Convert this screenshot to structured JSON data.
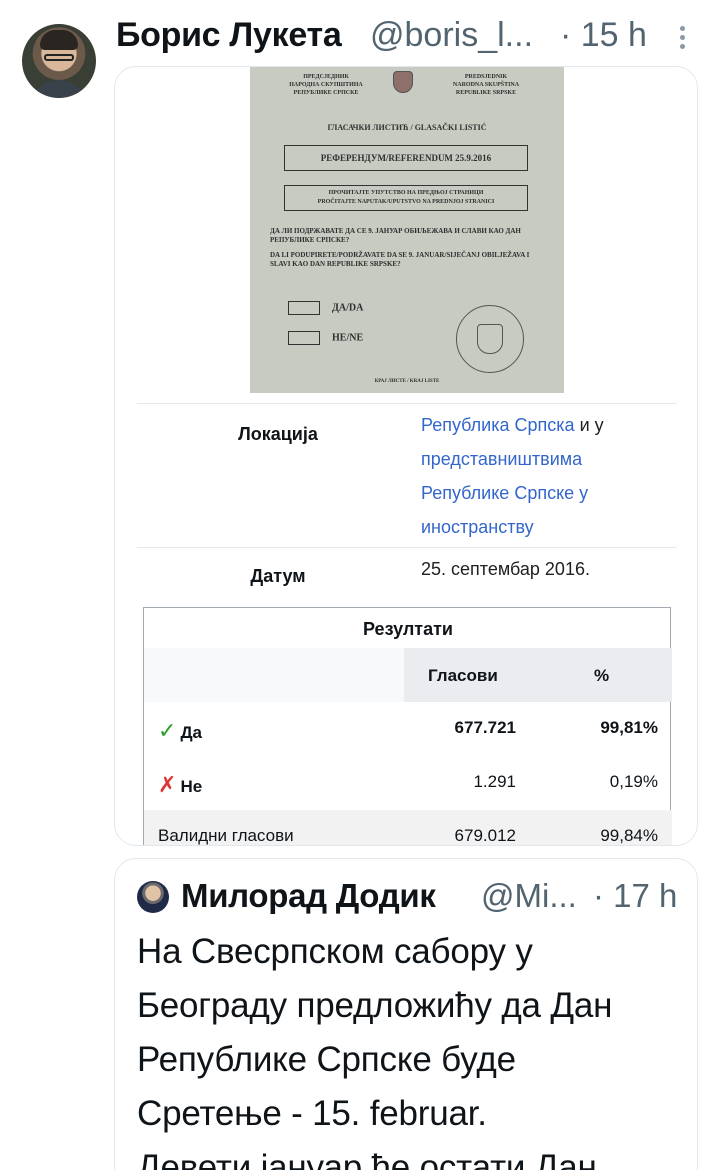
{
  "tweet": {
    "author_name": "Борис Лукета",
    "author_handle": "@boris_l...",
    "time": "· 15 h",
    "avatar_icon": "user-avatar"
  },
  "ballot": {
    "header_left": "ПРЕДСЈЕДНИК\nНАРОДНА СКУПШТИНА\nРЕПУБЛИКЕ СРПСКЕ",
    "header_right": "PREDSJEDNIK\nNARODNA SKUPŠTINA\nREPUBLIKE SRPSKE",
    "title": "ГЛАСАЧКИ ЛИСТИЋ / GLASAČKI LISTIĆ",
    "referendum": "РЕФЕРЕНДУМ/REFERENDUM 25.9.2016",
    "instructions": "ПРОЧИТАЈТЕ УПУТСТВО НА ПРЕДЊОЈ СТРАНИЦИ\nPROČITAJTE NAPUTAK/UPUTSTVO NA PREDNJOJ STRANICI",
    "question_cyr": "ДА ЛИ ПОДРЖАВАТЕ ДА СЕ 9. ЈАНУАР ОБИЉЕЖАВА И СЛАВИ КАО ДАН РЕПУБЛИКЕ СРПСКЕ?",
    "question_lat": "DA LI PODUPIRETE/PODRŽAVATE DA SE 9. JANUAR/SIJEČANJ OBILJEŽAVA I SLAVI KAO DAN REPUBLIKE SRPSKE?",
    "option_yes": "ДА/DA",
    "option_no": "НЕ/NE",
    "footer": "КРАЈ ЛИСТЕ / KRAJ LISTE"
  },
  "infobox": {
    "location_label": "Локација",
    "location_link1": "Република Српска",
    "location_conj": " и у",
    "location_link2": "представништвима",
    "location_link3": "Републике Српске у",
    "location_link4": "иностранству",
    "date_label": "Датум",
    "date_value": "25. септембар 2016."
  },
  "results": {
    "caption": "Резултати",
    "col_votes": "Гласови",
    "col_pct": "%",
    "rows": [
      {
        "name": "Да",
        "votes": "677.721",
        "pct": "99,81%",
        "icon": "check-icon"
      },
      {
        "name": "Не",
        "votes": "1.291",
        "pct": "0,19%",
        "icon": "cross-icon"
      },
      {
        "name": "Валидни гласови",
        "votes": "679.012",
        "pct": "99,84%"
      }
    ]
  },
  "quoted": {
    "author_name": "Милорад Додик",
    "author_handle": "@Mi...",
    "time": "· 17 h",
    "text_lines": [
      "На Свесрпском сабору у",
      "Београду предложићу да Дан",
      "Републике Српске буде",
      "Сретење - 15. februar.",
      "Девети јануар ће остати Дан..."
    ]
  }
}
